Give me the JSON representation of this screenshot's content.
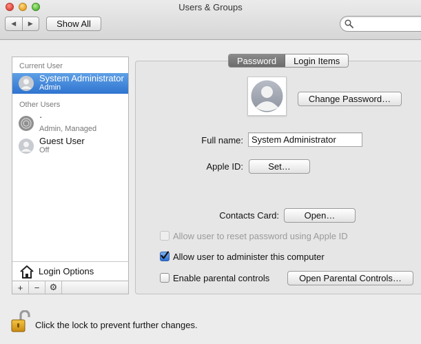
{
  "window": {
    "title": "Users & Groups"
  },
  "toolbar": {
    "show_all_label": "Show All",
    "search_placeholder": ""
  },
  "sidebar": {
    "current_user_header": "Current User",
    "other_users_header": "Other Users",
    "users": [
      {
        "name": "System Administrator",
        "role": "Admin",
        "selected": true
      },
      {
        "name": "·",
        "role": "Admin, Managed",
        "selected": false
      },
      {
        "name": "Guest User",
        "role": "Off",
        "selected": false
      }
    ],
    "login_options_label": "Login Options",
    "add_symbol": "+",
    "remove_symbol": "−",
    "action_symbol": "⚙"
  },
  "tabs": [
    {
      "label": "Password",
      "selected": true
    },
    {
      "label": "Login Items",
      "selected": false
    }
  ],
  "account": {
    "change_password_label": "Change Password…",
    "full_name_label": "Full name:",
    "full_name_value": "System Administrator",
    "apple_id_label": "Apple ID:",
    "apple_id_button": "Set…",
    "contacts_card_label": "Contacts Card:",
    "contacts_open_button": "Open…"
  },
  "options": [
    {
      "label": "Allow user to reset password using Apple ID",
      "checked": false,
      "enabled": false
    },
    {
      "label": "Allow user to administer this computer",
      "checked": true,
      "enabled": true
    },
    {
      "label": "Enable parental controls",
      "checked": false,
      "enabled": true
    }
  ],
  "parental": {
    "open_button": "Open Parental Controls…"
  },
  "lock": {
    "text": "Click the lock to prevent further changes."
  },
  "colors": {
    "selection": "#2f74d0",
    "checkbox_checked": "#2e6fd2"
  }
}
